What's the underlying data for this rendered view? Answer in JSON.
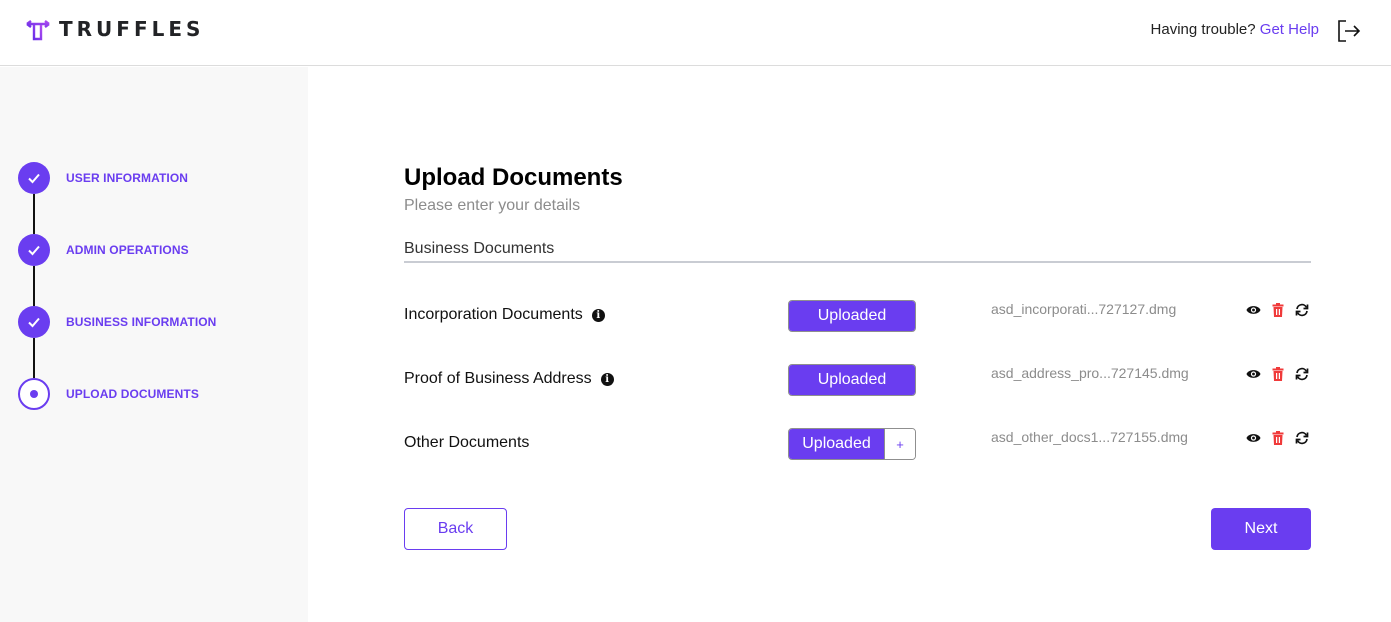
{
  "header": {
    "brand": "TRUFFLES",
    "help_text": "Having trouble?",
    "help_link": "Get Help",
    "logout_icon": "logout-icon"
  },
  "colors": {
    "accent": "#6a3df0",
    "danger": "#f03a3a",
    "muted": "#8c8c8c"
  },
  "steps": [
    {
      "label": "USER INFORMATION",
      "status": "completed"
    },
    {
      "label": "ADMIN OPERATIONS",
      "status": "completed"
    },
    {
      "label": "BUSINESS INFORMATION",
      "status": "completed"
    },
    {
      "label": "UPLOAD DOCUMENTS",
      "status": "current"
    }
  ],
  "main": {
    "title": "Upload Documents",
    "subtitle": "Please enter your details",
    "section_title": "Business Documents",
    "documents": [
      {
        "label": "Incorporation Documents",
        "has_info": true,
        "button": "Uploaded",
        "file": "asd_incorporati...727127.dmg"
      },
      {
        "label": "Proof of Business Address",
        "has_info": true,
        "button": "Uploaded",
        "file": "asd_address_pro...727145.dmg"
      },
      {
        "label": "Other Documents",
        "has_info": false,
        "button": "Uploaded",
        "add_label": "+",
        "file": "asd_other_docs1...727155.dmg"
      }
    ],
    "info_glyph": "i",
    "back_label": "Back",
    "next_label": "Next"
  }
}
